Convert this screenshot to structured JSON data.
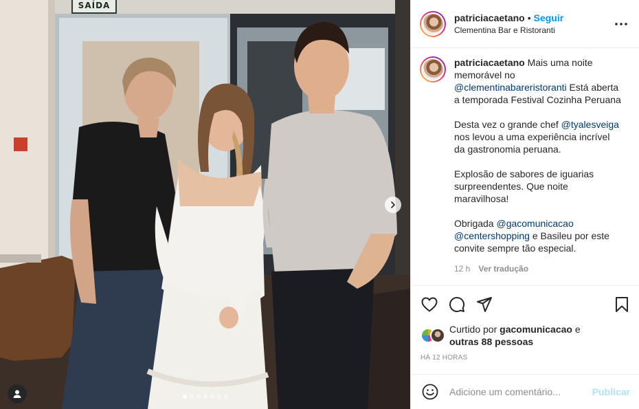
{
  "photo": {
    "exit_sign": "SAÍDA",
    "carousel": {
      "count": 7,
      "active_index": 0
    },
    "people": [
      "man-black-polo",
      "woman-white-dress",
      "man-checkered-shirt"
    ]
  },
  "header": {
    "username": "patriciacaetano",
    "separator": "•",
    "follow_label": "Seguir",
    "location": "Clementina Bar e Ristoranti"
  },
  "caption": {
    "username": "patriciacaetano",
    "p1_text_a": "Mais uma noite memorável no",
    "p1_mention": "@clementinabareristoranti",
    "p1_text_b": "Está aberta a temporada Festival Cozinha Peruana",
    "p2_text_a": "Desta vez o grande chef",
    "p2_mention": "@tyalesveiga",
    "p2_text_b": "nos levou a uma experiência incrível da gastronomia peruana.",
    "p3_text": "Explosão de sabores de iguarias surpreendentes. Que noite maravilhosa!",
    "p4_text_a": "Obrigada",
    "p4_mention_a": "@gacomunicacao",
    "p4_mention_b": "@centershopping",
    "p4_text_b": "e Basileu por este convite sempre tão especial.",
    "time": "12 h",
    "translate_label": "Ver tradução"
  },
  "likes": {
    "prefix": "Curtido por",
    "user": "gacomunicacao",
    "connector": "e",
    "others": "outras 88 pessoas"
  },
  "timestamp": "HÁ 12 HORAS",
  "comment": {
    "placeholder": "Adicione um comentário...",
    "publish_label": "Publicar"
  },
  "icons": {
    "header": [
      "more-options-icon"
    ],
    "actions": [
      "heart-icon",
      "comment-icon",
      "share-icon",
      "bookmark-icon"
    ],
    "comment": [
      "emoji-icon"
    ],
    "media": [
      "chevron-right-icon",
      "user-tag-icon"
    ]
  },
  "colors": {
    "link_blue": "#0095f6",
    "mention": "#00376b",
    "muted": "#8e8e8e",
    "text": "#262626",
    "publish_disabled": "#b2dffc"
  }
}
